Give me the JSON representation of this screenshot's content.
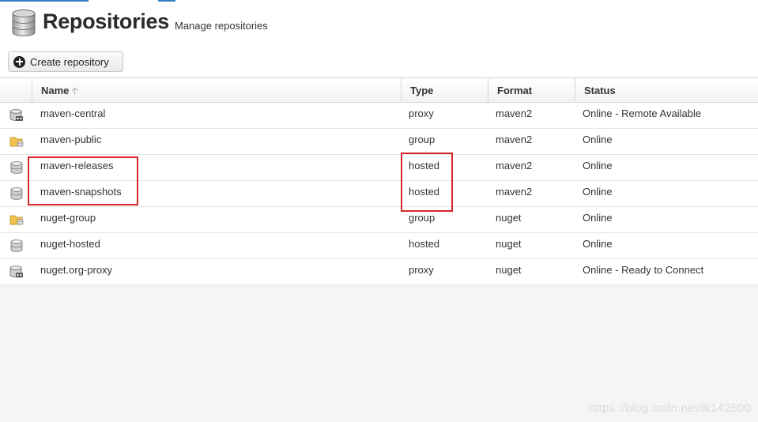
{
  "header": {
    "title": "Repositories",
    "subtitle": "Manage repositories",
    "icon": "database-icon"
  },
  "toolbar": {
    "create_label": "Create repository",
    "create_icon": "plus-circle-icon"
  },
  "table": {
    "columns": {
      "name": "Name",
      "type": "Type",
      "format": "Format",
      "status": "Status"
    },
    "sort": {
      "column": "Name",
      "direction": "ascending"
    },
    "rows": [
      {
        "icon": "proxy-repo-icon",
        "name": "maven-central",
        "type": "proxy",
        "format": "maven2",
        "status": "Online - Remote Available"
      },
      {
        "icon": "group-repo-icon",
        "name": "maven-public",
        "type": "group",
        "format": "maven2",
        "status": "Online"
      },
      {
        "icon": "hosted-repo-icon",
        "name": "maven-releases",
        "type": "hosted",
        "format": "maven2",
        "status": "Online"
      },
      {
        "icon": "hosted-repo-icon",
        "name": "maven-snapshots",
        "type": "hosted",
        "format": "maven2",
        "status": "Online"
      },
      {
        "icon": "group-repo-icon",
        "name": "nuget-group",
        "type": "group",
        "format": "nuget",
        "status": "Online"
      },
      {
        "icon": "hosted-repo-icon",
        "name": "nuget-hosted",
        "type": "hosted",
        "format": "nuget",
        "status": "Online"
      },
      {
        "icon": "proxy-repo-icon",
        "name": "nuget.org-proxy",
        "type": "proxy",
        "format": "nuget",
        "status": "Online - Ready to Connect"
      }
    ]
  },
  "colors": {
    "annotation": "#d9262c",
    "accent": "#2f7fc1"
  },
  "watermark": "https://blog.csdn.net/lk142500"
}
